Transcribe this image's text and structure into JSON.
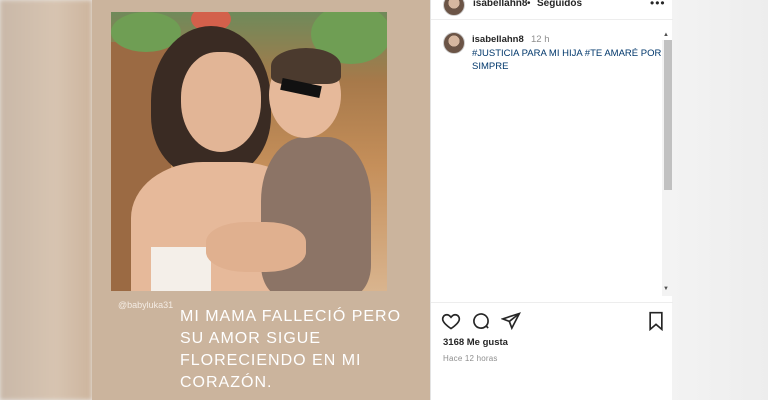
{
  "story": {
    "tag": "@babyluka31",
    "caption": "MI MAMA FALLECIÓ PERO\nSU AMOR SIGUE\nFLORECIENDO EN MI\nCORAZÓN."
  },
  "header": {
    "username": "isabellahn8",
    "separator": "•",
    "follow_status": "Seguidos",
    "more_icon": "more-icon"
  },
  "comment": {
    "username": "isabellahn8",
    "time": "12 h",
    "text": "#JUSTICIA PARA MI HIJA #TE AMARÉ POR SIMPRE"
  },
  "actions": {
    "icons": [
      "heart-icon",
      "comment-icon",
      "share-icon",
      "save-icon"
    ],
    "likes": "3168 Me gusta",
    "posted": "Hace 12 horas"
  },
  "colors": {
    "link": "#00376b",
    "text": "#262626",
    "muted": "#8e8e8e",
    "story_bg": "#cbb49d"
  }
}
